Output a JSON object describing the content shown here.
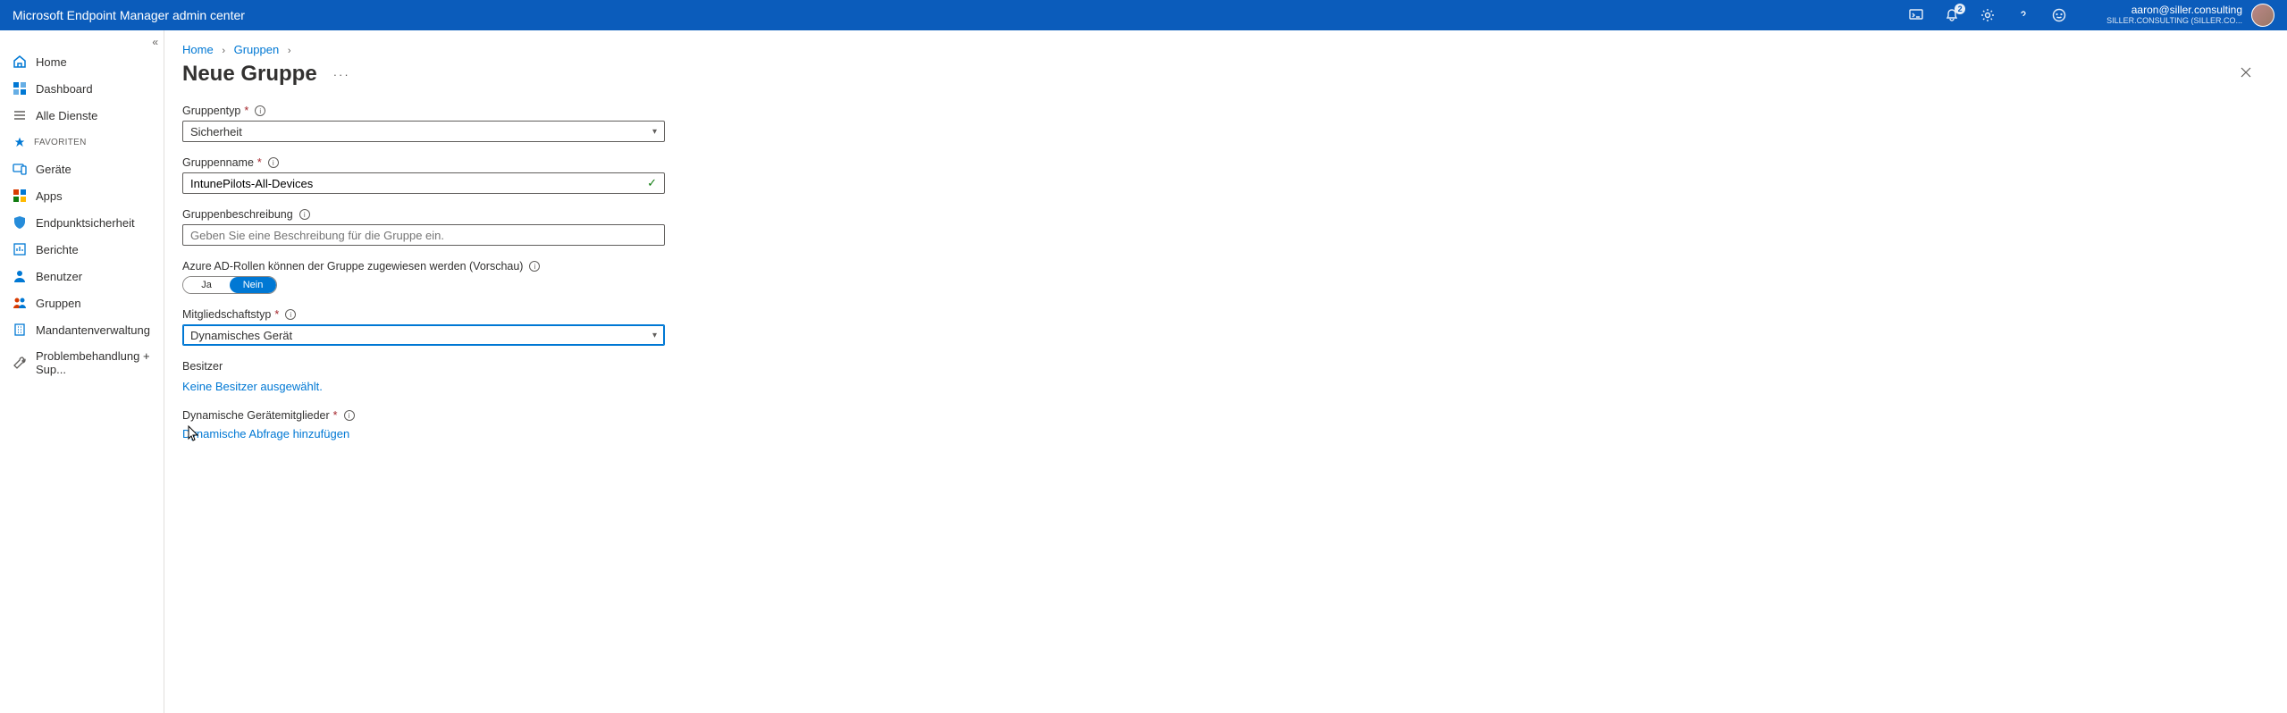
{
  "header": {
    "title": "Microsoft Endpoint Manager admin center",
    "bell_badge": "2",
    "user_email": "aaron@siller.consulting",
    "user_org": "SILLER.CONSULTING (SILLER.CO..."
  },
  "sidebar": {
    "items": [
      {
        "label": "Home",
        "icon": "home"
      },
      {
        "label": "Dashboard",
        "icon": "dashboard"
      },
      {
        "label": "Alle Dienste",
        "icon": "list"
      }
    ],
    "fav_label": "FAVORITEN",
    "fav_items": [
      {
        "label": "Geräte",
        "icon": "device"
      },
      {
        "label": "Apps",
        "icon": "apps"
      },
      {
        "label": "Endpunktsicherheit",
        "icon": "shield"
      },
      {
        "label": "Berichte",
        "icon": "report"
      },
      {
        "label": "Benutzer",
        "icon": "user"
      },
      {
        "label": "Gruppen",
        "icon": "group"
      },
      {
        "label": "Mandantenverwaltung",
        "icon": "tenant"
      },
      {
        "label": "Problembehandlung + Sup...",
        "icon": "wrench"
      }
    ]
  },
  "breadcrumb": {
    "home": "Home",
    "groups": "Gruppen"
  },
  "page": {
    "title": "Neue Gruppe"
  },
  "form": {
    "grouptype_label": "Gruppentyp",
    "grouptype_value": "Sicherheit",
    "groupname_label": "Gruppenname",
    "groupname_value": "IntunePilots-All-Devices",
    "groupdesc_label": "Gruppenbeschreibung",
    "groupdesc_placeholder": "Geben Sie eine Beschreibung für die Gruppe ein.",
    "aadroles_label": "Azure AD-Rollen können der Gruppe zugewiesen werden (Vorschau)",
    "toggle_yes": "Ja",
    "toggle_no": "Nein",
    "membership_label": "Mitgliedschaftstyp",
    "membership_value": "Dynamisches Gerät",
    "owners_label": "Besitzer",
    "owners_link": "Keine Besitzer ausgewählt.",
    "dynmembers_label": "Dynamische Gerätemitglieder",
    "dynmembers_link": "Dynamische Abfrage hinzufügen"
  }
}
